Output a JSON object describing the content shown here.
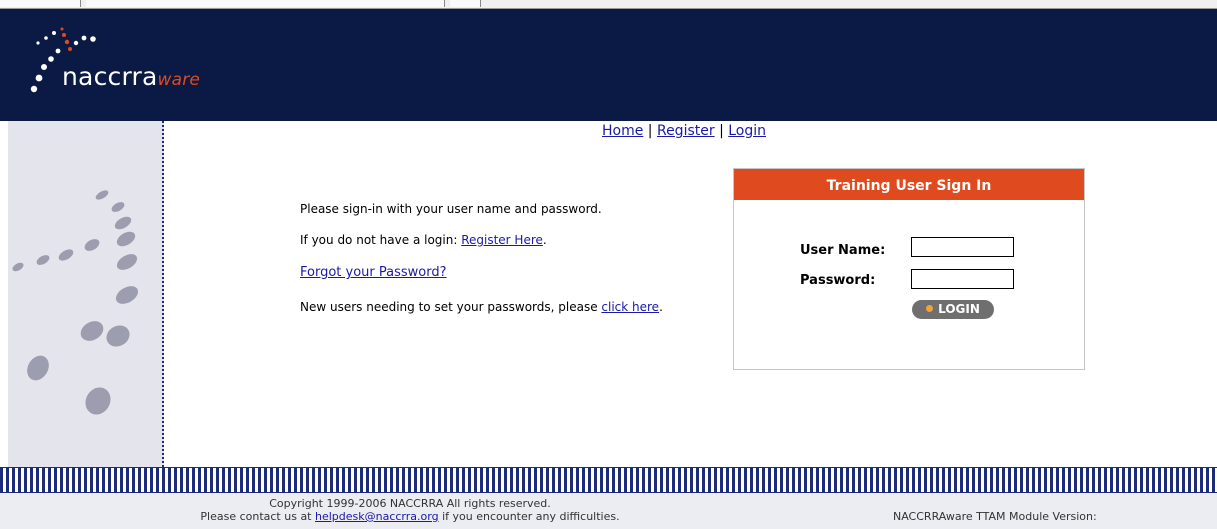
{
  "logo": {
    "brand_main": "naccrra",
    "brand_suffix": "ware"
  },
  "nav": {
    "home": "Home",
    "separator": "|",
    "register": "Register",
    "login": "Login"
  },
  "intro": {
    "line1": "Please sign-in with your user name and password.",
    "line2_prefix": "If you do not have a login: ",
    "register_here": "Register Here",
    "line2_suffix": ".",
    "forgot_password": "Forgot your Password?",
    "line4_prefix": "New users needing to set your passwords, please ",
    "click_here": "click here",
    "line4_suffix": "."
  },
  "signin": {
    "title": "Training User Sign In",
    "username_label": "User Name:",
    "password_label": "Password:",
    "username_value": "",
    "password_value": "",
    "login_button": "LOGIN"
  },
  "footer": {
    "copyright": "Copyright 1999-2006 NACCRRA All rights reserved.",
    "contact_prefix": "Please contact us at ",
    "contact_email": "helpdesk@naccrra.org",
    "contact_suffix": " if you encounter any difficulties.",
    "version": "NACCRRAware TTAM Module Version:"
  },
  "colors": {
    "header_bg": "#0a1a44",
    "accent_orange": "#e04a1f",
    "side_panel": "#e3e4ec",
    "stripe_blue": "#1c2c7a",
    "button_grey": "#6f6f6f"
  },
  "icons": {
    "logo_mark": "dot-swirl-icon",
    "side_graphic": "decorative-dots-icon",
    "button_bullet": "bullet-dot-icon"
  }
}
